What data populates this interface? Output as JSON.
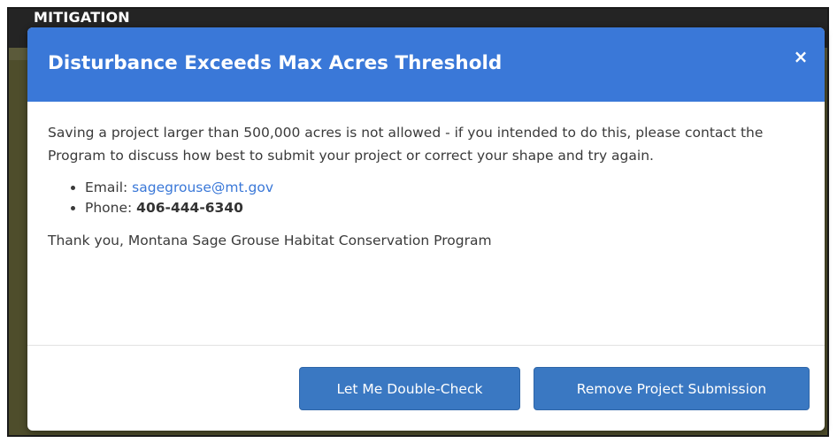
{
  "background_panel": {
    "header_label": "MITIGATION"
  },
  "dialog": {
    "title": "Disturbance Exceeds Max Acres Threshold",
    "close_symbol": "×",
    "message": "Saving a project larger than 500,000 acres is not allowed - if you intended to do this, please contact the Program to discuss how best to submit your project or correct your shape and try again.",
    "contacts": {
      "email_label": "Email: ",
      "email_value": "sagegrouse@mt.gov",
      "phone_label": "Phone: ",
      "phone_value": "406-444-6340"
    },
    "closing": "Thank you, Montana Sage Grouse Habitat Conservation Program",
    "buttons": {
      "double_check": "Let Me Double-Check",
      "remove": "Remove Project Submission"
    }
  },
  "colors": {
    "header_blue": "#3a78d8",
    "button_blue": "#3a78c2",
    "link_blue": "#3a78d8",
    "backdrop_olive": "#4e4d2b"
  }
}
